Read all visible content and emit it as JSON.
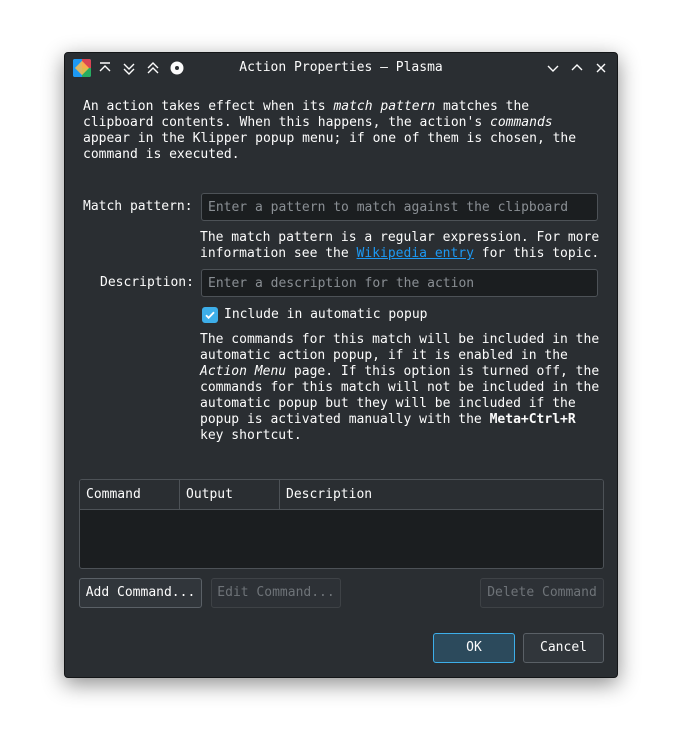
{
  "window": {
    "title": "Action Properties — Plasma"
  },
  "intro": {
    "line1_a": "An action takes effect when its ",
    "line1_em": "match pattern",
    "line1_b": " matches the",
    "line2_a": "clipboard contents. When this happens, the action's ",
    "line2_em": "commands",
    "line3": "appear in the Klipper popup menu; if one of them is chosen, the",
    "line4": "command is executed."
  },
  "match_pattern": {
    "label": "Match pattern:",
    "value": "",
    "placeholder": "Enter a pattern to match against the clipboard",
    "help_line1": "The match pattern is a regular expression. For more",
    "help_line2_a": "information see the ",
    "help_link": "Wikipedia entry",
    "help_line2_b": " for this topic."
  },
  "description": {
    "label": "Description:",
    "value": "",
    "placeholder": "Enter a description for the action"
  },
  "auto_popup": {
    "label": "Include in automatic popup",
    "checked": true,
    "help_line1": "The commands for this match will be included in the",
    "help_line2": "automatic action popup, if it is enabled in the",
    "help_line3_em": "Action Menu",
    "help_line3_b": " page. If this option is turned off, the",
    "help_line4": "commands for this match will not be included in the",
    "help_line5": "automatic popup but they will be included if the",
    "help_line6_a": "popup is activated manually with the ",
    "help_line6_strong": "Meta+Ctrl+R",
    "help_line7": "key shortcut."
  },
  "commands_table": {
    "columns": [
      "Command",
      "Output",
      "Description"
    ],
    "rows": []
  },
  "buttons": {
    "add_command": "Add Command...",
    "edit_command": "Edit Command...",
    "delete_command": "Delete Command",
    "ok": "OK",
    "cancel": "Cancel"
  },
  "colors": {
    "window_bg": "#2a2e32",
    "field_bg": "#1b1e20",
    "accent": "#3daee9",
    "link": "#1d99f3",
    "text": "#fcfcfc",
    "disabled_text": "#6e7378"
  },
  "icons": {
    "app": "klipper-app-icon",
    "keep_above": "keep-above-icon",
    "keep_below": "keep-below-icon",
    "shade": "shade-icon",
    "on_all_desktops": "on-all-desktops-icon",
    "minimize": "minimize-icon",
    "maximize": "maximize-icon",
    "close": "close-icon",
    "check": "check-icon"
  }
}
